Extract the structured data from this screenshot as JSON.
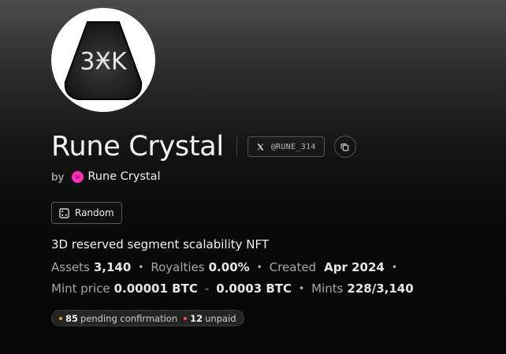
{
  "collection": {
    "name": "Rune Crystal",
    "avatar_icon": "crystal-3x-logo",
    "avatar_glyph": "3ӾK"
  },
  "social": {
    "x_handle": "@RUNE_314",
    "x_icon": "x-logo-icon",
    "copy_icon": "copy-icon"
  },
  "creator": {
    "by_label": "by",
    "name": "Rune Crystal",
    "avatar_color": "#ff2fb6"
  },
  "random_button": {
    "label": "Random",
    "icon": "dice-icon"
  },
  "description": "3D reserved segment scalability NFT",
  "stats": {
    "assets_label": "Assets",
    "assets_value": "3,140",
    "royalties_label": "Royalties",
    "royalties_value": "0.00%",
    "created_label": "Created",
    "created_value": "Apr 2024",
    "mint_price_label": "Mint price",
    "mint_price_min": "0.00001 BTC",
    "range_sep": "-",
    "mint_price_max": "0.0003 BTC",
    "mints_label": "Mints",
    "mints_value": "228/3,140"
  },
  "status": {
    "pending_count": "85",
    "pending_label": "pending confirmation",
    "pending_color": "#f0a020",
    "unpaid_count": "12",
    "unpaid_label": "unpaid",
    "unpaid_color": "#ff4a4a"
  }
}
